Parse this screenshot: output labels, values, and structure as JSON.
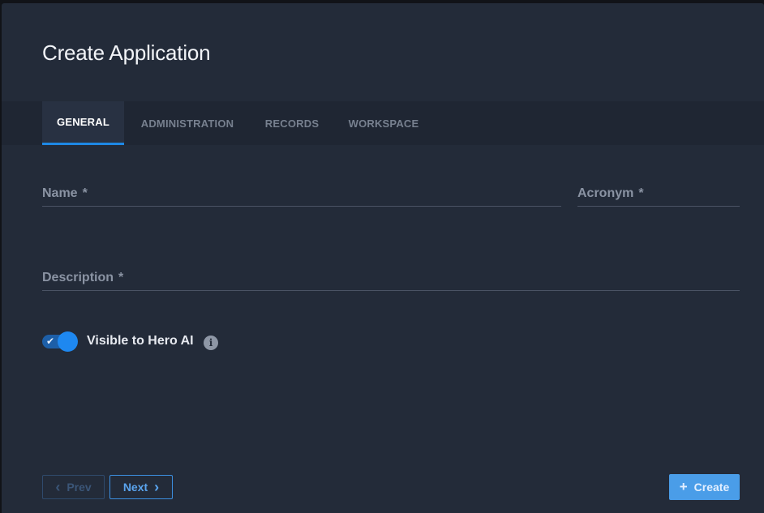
{
  "dialog": {
    "title": "Create Application"
  },
  "tabs": [
    {
      "label": "GENERAL",
      "active": true
    },
    {
      "label": "ADMINISTRATION",
      "active": false
    },
    {
      "label": "RECORDS",
      "active": false
    },
    {
      "label": "WORKSPACE",
      "active": false
    }
  ],
  "form": {
    "name": {
      "label": "Name",
      "required_mark": "*",
      "value": ""
    },
    "acronym": {
      "label": "Acronym",
      "required_mark": "*",
      "value": ""
    },
    "description": {
      "label": "Description",
      "required_mark": "*",
      "value": ""
    },
    "visible_toggle": {
      "label": "Visible to Hero AI",
      "checked": true,
      "check_glyph": "✔",
      "info_glyph": "i"
    }
  },
  "footer": {
    "prev_label": "Prev",
    "next_label": "Next",
    "create_label": "Create",
    "prev_icon": "chevron-left-icon",
    "next_icon": "chevron-right-icon",
    "create_icon": "plus-icon"
  },
  "colors": {
    "background": "#232b39",
    "accent": "#1e88e5",
    "create_button": "#4a9de8"
  }
}
